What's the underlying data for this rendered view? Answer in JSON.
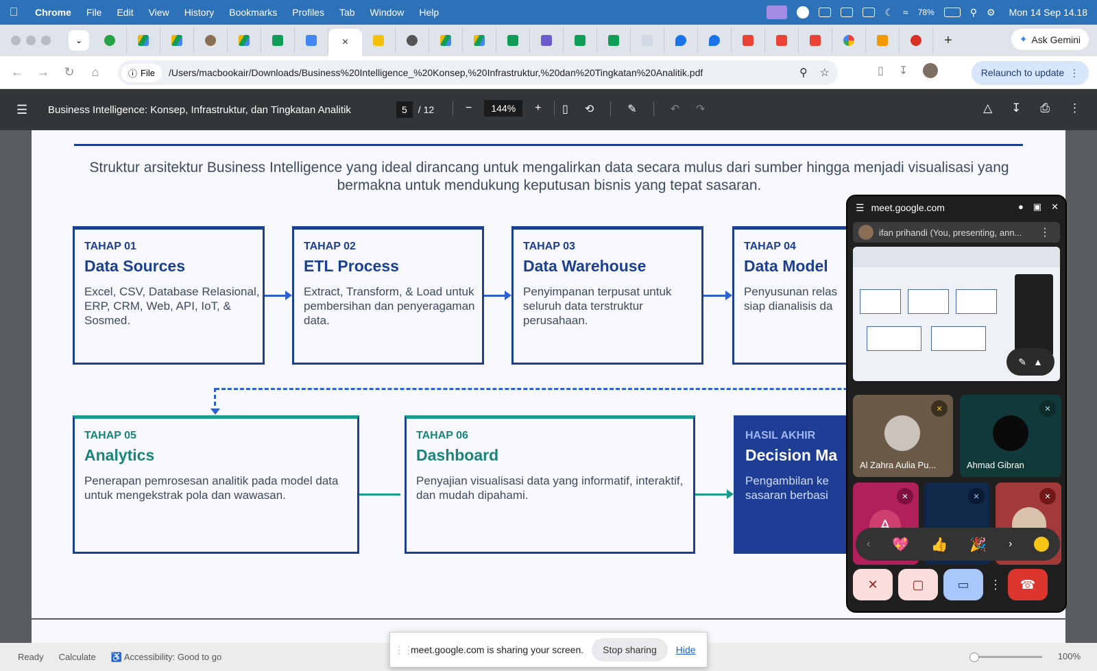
{
  "menubar": {
    "apple": "",
    "app": "Chrome",
    "items": [
      "File",
      "Edit",
      "View",
      "History",
      "Bookmarks",
      "Profiles",
      "Tab",
      "Window",
      "Help"
    ],
    "battery": "78%",
    "datetime": "Mon 14 Sep  14.18"
  },
  "tabs": {
    "new_tab": "+",
    "close": "×",
    "gemini": "Ask Gemini"
  },
  "addressbar": {
    "chip": "File",
    "url": "/Users/macbookair/Downloads/Business%20Intelligence_%20Konsep,%20Infrastruktur,%20dan%20Tingkatan%20Analitik.pdf",
    "relaunch": "Relaunch to update"
  },
  "pdf": {
    "title": "Business Intelligence: Konsep, Infrastruktur, dan Tingkatan Analitik",
    "page": "5",
    "total": "/ 12",
    "zoom": "144%",
    "intro": "Struktur arsitektur Business Intelligence yang ideal dirancang untuk mengalirkan data secara mulus dari sumber hingga menjadi visualisasi yang bermakna untuk mendukung keputusan bisnis yang tepat sasaran.",
    "stages": [
      {
        "stage": "TAHAP 01",
        "title": "Data Sources",
        "desc": "Excel, CSV, Database Relasional, ERP, CRM, Web, API, IoT, & Sosmed."
      },
      {
        "stage": "TAHAP 02",
        "title": "ETL Process",
        "desc": "Extract, Transform, & Load untuk pembersihan dan penyeragaman data."
      },
      {
        "stage": "TAHAP 03",
        "title": "Data Warehouse",
        "desc": "Penyimpanan terpusat untuk seluruh data terstruktur perusahaan."
      },
      {
        "stage": "TAHAP 04",
        "title": "Data Model",
        "desc": "Penyusunan relas siap dianalisis da"
      },
      {
        "stage": "TAHAP 05",
        "title": "Analytics",
        "desc": "Penerapan pemrosesan analitik pada model data untuk mengekstrak pola dan wawasan."
      },
      {
        "stage": "TAHAP 06",
        "title": "Dashboard",
        "desc": "Penyajian visualisasi data yang informatif, interaktif, dan mudah dipahami."
      },
      {
        "stage": "HASIL AKHIR",
        "title": "Decision Ma",
        "desc": "Pengambilan ke sasaran berbasi"
      }
    ]
  },
  "statusbar": {
    "ready": "Ready",
    "calculate": "Calculate",
    "accessibility": "Accessibility: Good to go",
    "zoom": "100%"
  },
  "sharebar": {
    "message": "meet.google.com is sharing your screen.",
    "stop": "Stop sharing",
    "hide": "Hide"
  },
  "meet": {
    "domain": "meet.google.com",
    "presenter": "ifan prihandi (You, presenting, ann...",
    "participants": [
      {
        "name": "Al Zahra Aulia Pu..."
      },
      {
        "name": "Ahmad Gibran"
      },
      {
        "name": "A"
      }
    ],
    "reactions": [
      "💖",
      "👍",
      "🎉"
    ]
  }
}
